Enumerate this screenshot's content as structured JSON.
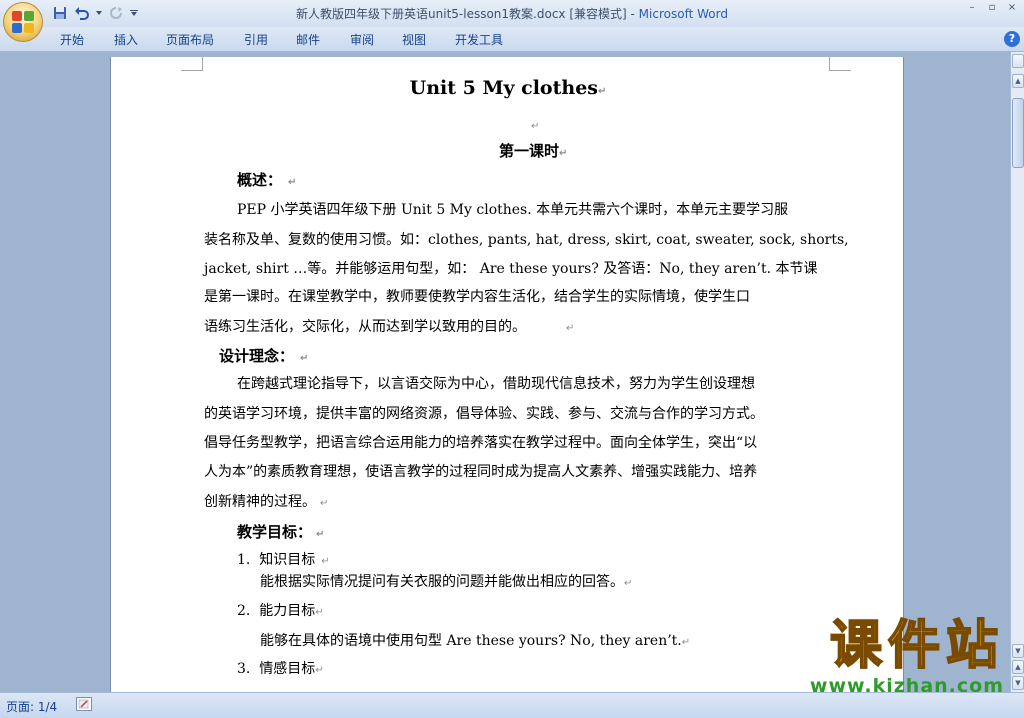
{
  "window": {
    "title": "新人教版四年级下册英语unit5-lesson1教案.docx [兼容模式]",
    "separator": " - ",
    "app_name": "Microsoft Word",
    "controls": [
      "–",
      "▫",
      "×"
    ]
  },
  "ribbon": {
    "tabs": [
      "开始",
      "插入",
      "页面布局",
      "引用",
      "邮件",
      "审阅",
      "视图",
      "开发工具"
    ],
    "help": "?"
  },
  "document": {
    "title": "Unit  5 My  clothes",
    "mark": "↵",
    "lesson": "第一课时",
    "overview_heading": "概述：",
    "overview_lines": [
      "PEP 小学英语四年级下册 Unit 5 My clothes.  本单元共需六个课时，本单元主要学习服",
      "装名称及单、复数的使用习惯。如：clothes, pants, hat, dress, skirt, coat, sweater, sock, shorts,",
      "jacket, shirt …等。并能够运用句型，如：  Are these yours?  及答语：No, they aren’t.  本节课",
      "是第一课时。在课堂教学中，教师要使教学内容生活化，结合学生的实际情境，使学生口",
      "语练习生活化，交际化，从而达到学以致用的目的。"
    ],
    "concept_heading": "设计理念：",
    "concept_lines": [
      "在跨越式理论指导下，以言语交际为中心，借助现代信息技术，努力为学生创设理想",
      "的英语学习环境，提供丰富的网络资源，倡导体验、实践、参与、交流与合作的学习方式。",
      "倡导任务型教学，把语言综合运用能力的培养落实在教学过程中。面向全体学生，突出“以",
      "人为本”的素质教育理想，使语言教学的过程同时成为提高人文素养、增强实践能力、培养",
      "创新精神的过程。"
    ],
    "goals_heading": "教学目标：",
    "goals": [
      {
        "num": "1.",
        "label": "知识目标",
        "detail": "能根据实际情况提问有关衣服的问题并能做出相应的回答。"
      },
      {
        "num": "2.",
        "label": "能力目标",
        "detail": "能够在具体的语境中使用句型 Are these yours?  No, they aren’t."
      },
      {
        "num": "3.",
        "label": "情感目标",
        "detail": ""
      }
    ]
  },
  "statusbar": {
    "page": "页面: 1/4"
  },
  "watermark": {
    "logo": "课件站",
    "url": "www.kjzhan.com"
  }
}
